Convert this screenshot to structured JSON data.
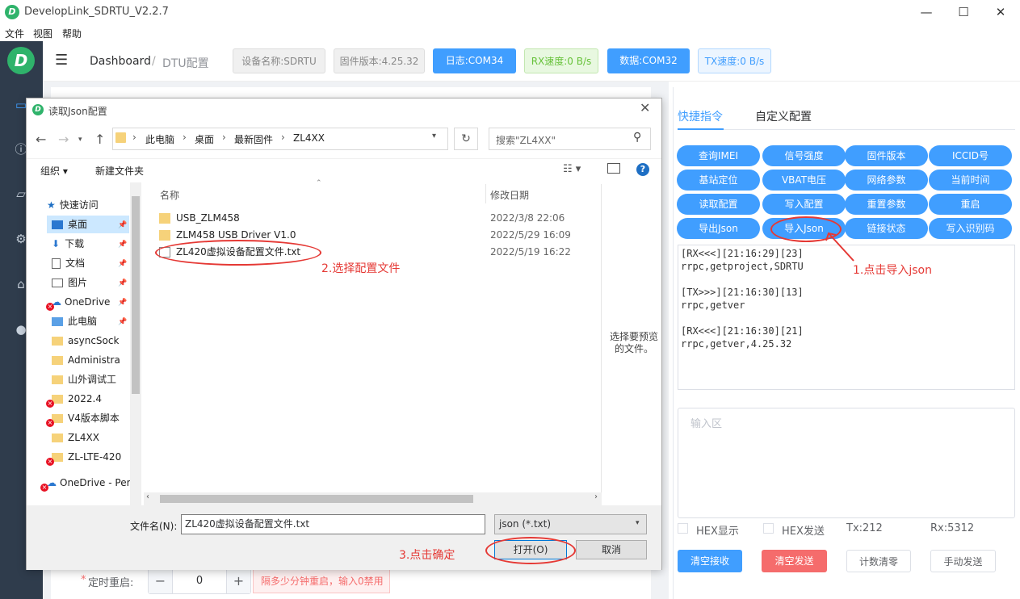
{
  "window": {
    "title": "DevelopLink_SDRTU_V2.2.7",
    "logo": "D"
  },
  "menubar": [
    "文件",
    "视图",
    "帮助"
  ],
  "header": {
    "breadcrumb_home": "Dashboard",
    "breadcrumb_sep": "/",
    "breadcrumb_page": "DTU配置",
    "device_name": "设备名称:SDRTU",
    "firmware": "固件版本:4.25.32",
    "log_port": "日志:COM34",
    "rx_speed": "RX速度:0 B/s",
    "data_port": "数据:COM32",
    "tx_speed": "TX速度:0 B/s"
  },
  "right": {
    "tabs": [
      "快捷指令",
      "自定义配置"
    ],
    "commands": [
      "查询IMEI",
      "信号强度",
      "固件版本",
      "ICCID号",
      "基站定位",
      "VBAT电压",
      "网络参数",
      "当前时间",
      "读取配置",
      "写入配置",
      "重置参数",
      "重启",
      "导出Json",
      "导入Json",
      "链接状态",
      "写入识别码"
    ],
    "log_text": "[RX<<<][21:16:29][23]\nrrpc,getproject,SDRTU\n\n[TX>>>][21:16:30][13]\nrrpc,getver\n\n[RX<<<][21:16:30][21]\nrrpc,getver,4.25.32",
    "input_placeholder": "输入区",
    "hex_show": "HEX显示",
    "hex_send": "HEX发送",
    "tx": "Tx:212",
    "rx": "Rx:5312",
    "btn_clear_rx": "清空接收",
    "btn_clear_tx": "清空发送",
    "btn_reset_count": "计数清零",
    "btn_manual_send": "手动发送"
  },
  "reboot": {
    "label": "定时重启:",
    "star": "*",
    "minus": "−",
    "plus": "+",
    "value": "0",
    "tip": "隔多少分钟重启，输入0禁用"
  },
  "dialog": {
    "title": "读取Json配置",
    "logo": "D",
    "crumbs": [
      "此电脑",
      "桌面",
      "最新固件",
      "ZL4XX"
    ],
    "search_placeholder": "搜索\"ZL4XX\"",
    "organize": "组织 ▾",
    "new_folder": "新建文件夹",
    "tree": [
      "快速访问",
      "桌面",
      "下载",
      "文档",
      "图片",
      "OneDrive",
      "此电脑",
      "asyncSock",
      "Administra",
      "山外调试工",
      "2022.4",
      "V4版本脚本",
      "ZL4XX",
      "ZL-LTE-420",
      "OneDrive - Per"
    ],
    "col_name": "名称",
    "col_date": "修改日期",
    "files": [
      {
        "name": "USB_ZLM458",
        "date": "2022/3/8 22:06"
      },
      {
        "name": "ZLM458 USB Driver V1.0",
        "date": "2022/5/29 16:09"
      },
      {
        "name": "ZL420虚拟设备配置文件.txt",
        "date": "2022/5/19 16:22"
      }
    ],
    "preview_text": "选择要预览的文件。",
    "filename_label": "文件名(N):",
    "filename_value": "ZL420虚拟设备配置文件.txt",
    "filetype": "json (*.txt)",
    "open": "打开(O)",
    "cancel": "取消"
  },
  "annotations": {
    "step1": "1.点击导入json",
    "step2": "2.选择配置文件",
    "step3": "3.点击确定"
  },
  "colors": {
    "accent": "#409eff",
    "nav": "#2f3c4c",
    "brand": "#2fb36b",
    "annotation": "#e53935"
  }
}
